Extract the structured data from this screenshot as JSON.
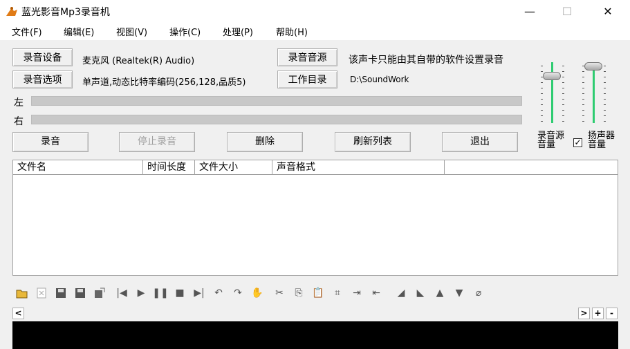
{
  "window": {
    "title": "蓝光影音Mp3录音机",
    "minimize": "—",
    "maximize": "☐",
    "close": "✕"
  },
  "menu": [
    "文件(F)",
    "编辑(E)",
    "视图(V)",
    "操作(C)",
    "处理(P)",
    "帮助(H)"
  ],
  "device": {
    "device_button": "录音设备",
    "device_value": "麦克风 (Realtek(R) Audio)",
    "source_button": "录音音源",
    "source_value": "该声卡只能由其自带的软件设置录音",
    "options_button": "录音选项",
    "options_value": "单声道,动态比特率编码(256,128,品质5)",
    "workdir_button": "工作目录",
    "workdir_value": "D:\\SoundWork"
  },
  "meters": {
    "left_label": "左",
    "right_label": "右"
  },
  "actions": {
    "record": "录音",
    "stop": "停止录音",
    "delete": "删除",
    "refresh": "刷新列表",
    "exit": "退出"
  },
  "volume": {
    "source_label_1": "录音源",
    "source_label_2": "音量",
    "speaker_label_1": "扬声器",
    "speaker_label_2": "音量",
    "speaker_checked": "✓"
  },
  "table": {
    "columns": [
      "文件名",
      "时间长度",
      "文件大小",
      "声音格式"
    ]
  },
  "scroll": {
    "left": "<",
    "right": ">",
    "plus": "+",
    "minus": "-"
  },
  "toolbar_icons": [
    "open-icon",
    "close-file-icon",
    "save-icon",
    "save-as-icon",
    "export-icon",
    "skip-start-icon",
    "play-icon",
    "pause-icon",
    "stop-icon",
    "skip-end-icon",
    "undo-icon",
    "redo-icon",
    "hand-icon",
    "cut-icon",
    "copy-icon",
    "paste-icon",
    "select-icon",
    "zoom-in-icon",
    "zoom-out-icon",
    "fade-in-icon",
    "fade-out-icon",
    "volume-up-icon",
    "volume-down-icon",
    "clear-icon"
  ]
}
